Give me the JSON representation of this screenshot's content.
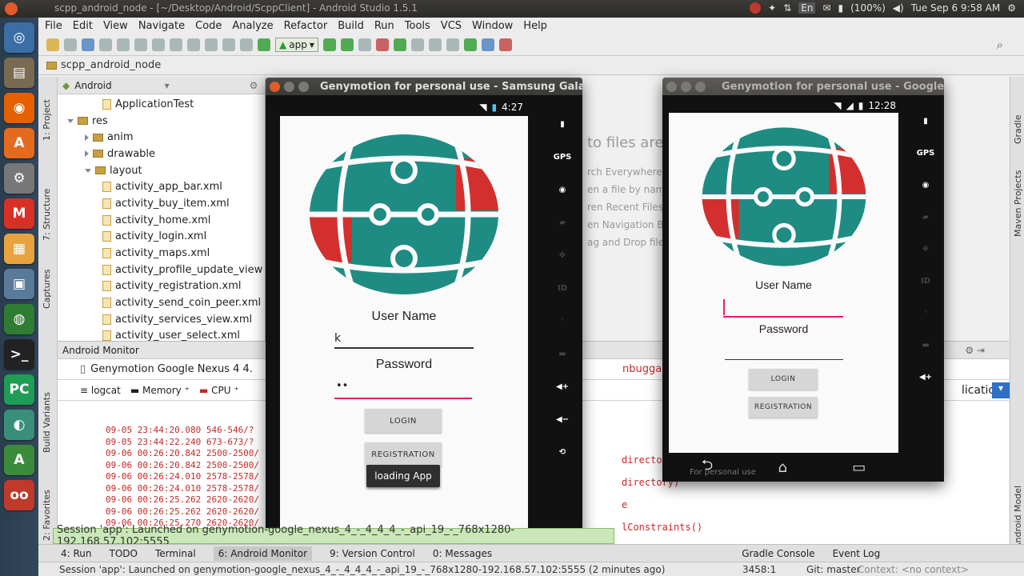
{
  "topbar": {
    "title": "scpp_android_node - [~/Desktop/Android/ScppClient] - Android Studio 1.5.1",
    "lang": "En",
    "battery": "(100%)",
    "clock": "Tue Sep  6  9:58 AM"
  },
  "menu": [
    "File",
    "Edit",
    "View",
    "Navigate",
    "Code",
    "Analyze",
    "Refactor",
    "Build",
    "Run",
    "Tools",
    "VCS",
    "Window",
    "Help"
  ],
  "toolbar": {
    "app_selector": "app"
  },
  "breadcrumb": "scpp_android_node",
  "side_tabs": {
    "project": "1: Project",
    "structure": "7: Structure",
    "captures": "Captures",
    "build_variants": "Build Variants",
    "favorites": "2: Favorites",
    "gradle": "Gradle",
    "maven": "Maven Projects",
    "android_model": "Android Model"
  },
  "project_panel": {
    "view": "Android",
    "items": [
      {
        "label": "ApplicationTest",
        "indent": 3,
        "type": "file"
      },
      {
        "label": "res",
        "indent": 1,
        "type": "folder",
        "open": true
      },
      {
        "label": "anim",
        "indent": 2,
        "type": "folder"
      },
      {
        "label": "drawable",
        "indent": 2,
        "type": "folder"
      },
      {
        "label": "layout",
        "indent": 2,
        "type": "folder",
        "open": true
      },
      {
        "label": "activity_app_bar.xml",
        "indent": 3,
        "type": "file"
      },
      {
        "label": "activity_buy_item.xml",
        "indent": 3,
        "type": "file"
      },
      {
        "label": "activity_home.xml",
        "indent": 3,
        "type": "file"
      },
      {
        "label": "activity_login.xml",
        "indent": 3,
        "type": "file"
      },
      {
        "label": "activity_maps.xml",
        "indent": 3,
        "type": "file"
      },
      {
        "label": "activity_profile_update_view",
        "indent": 3,
        "type": "file"
      },
      {
        "label": "activity_registration.xml",
        "indent": 3,
        "type": "file"
      },
      {
        "label": "activity_send_coin_peer.xml",
        "indent": 3,
        "type": "file"
      },
      {
        "label": "activity_services_view.xml",
        "indent": 3,
        "type": "file"
      },
      {
        "label": "activity_user_select.xml",
        "indent": 3,
        "type": "file"
      }
    ]
  },
  "editor_hints": {
    "title": "to files are c",
    "lines": [
      "rch Everywhere",
      "en a file by nam",
      "ren Recent Files",
      "en Navigation B",
      "ag and Drop file"
    ]
  },
  "monitor": {
    "title": "Android Monitor",
    "device": "Genymotion Google Nexus 4   4.",
    "tabs": [
      "logcat",
      "Memory",
      "CPU"
    ],
    "debuggable": "nbuggable Appl",
    "filter": "lication",
    "logs": [
      "09-05 23:44:20.080 546-546/?",
      "09-05 23:44:22.240 673-673/?",
      "09-06 00:26:20.842 2500-2500/",
      "09-06 00:26:20.842 2500-2500/",
      "09-06 00:26:24.010 2578-2578/",
      "09-06 00:26:24.010 2578-2578/",
      "09-06 00:26:25.262 2620-2620/",
      "09-06 00:26:25.262 2620-2620/",
      "09-06 00:26:25.270 2620-2620/",
      "09-06 00:26:25.270 2620-2620/"
    ],
    "logs_right": [
      "directory)",
      "directory)",
      "e",
      "lConstraints()"
    ]
  },
  "balloon": "Session 'app': Launched on genymotion-google_nexus_4_-_4_4_4_-_api_19_-_768x1280-192.168.57.102:5555",
  "toolwindows": [
    "4: Run",
    "TODO",
    "Terminal",
    "6: Android Monitor",
    "9: Version Control",
    "0: Messages",
    "Gradle Console",
    "Event Log"
  ],
  "statusbar": {
    "message": "Session 'app': Launched on genymotion-google_nexus_4_-_4_4_4_-_api_19_-_768x1280-192.168.57.102:5555 (2 minutes ago)",
    "position": "3458:1",
    "git": "Git: master",
    "context": "Context: <no context>"
  },
  "emu1": {
    "title": "Genymotion for personal use - Samsung Galaxy",
    "time": "4:27",
    "user_label": "User Name",
    "user_value": "k",
    "pass_label": "Password",
    "pass_value": "••",
    "login": "LOGIN",
    "register": "REGISTRATION",
    "toast": "loading App",
    "gps": "GPS",
    "id": "ID"
  },
  "emu2": {
    "title": "Genymotion for personal use - Google N",
    "time": "12:28",
    "user_label": "User Name",
    "pass_label": "Password",
    "login": "LOGIN",
    "register": "REGISTRATION",
    "gps": "GPS",
    "id": "ID",
    "bottom": "For personal use"
  },
  "colors": {
    "globe_teal": "#1f8c84",
    "globe_red": "#d32f2f",
    "accent_pink": "#e91e63"
  }
}
